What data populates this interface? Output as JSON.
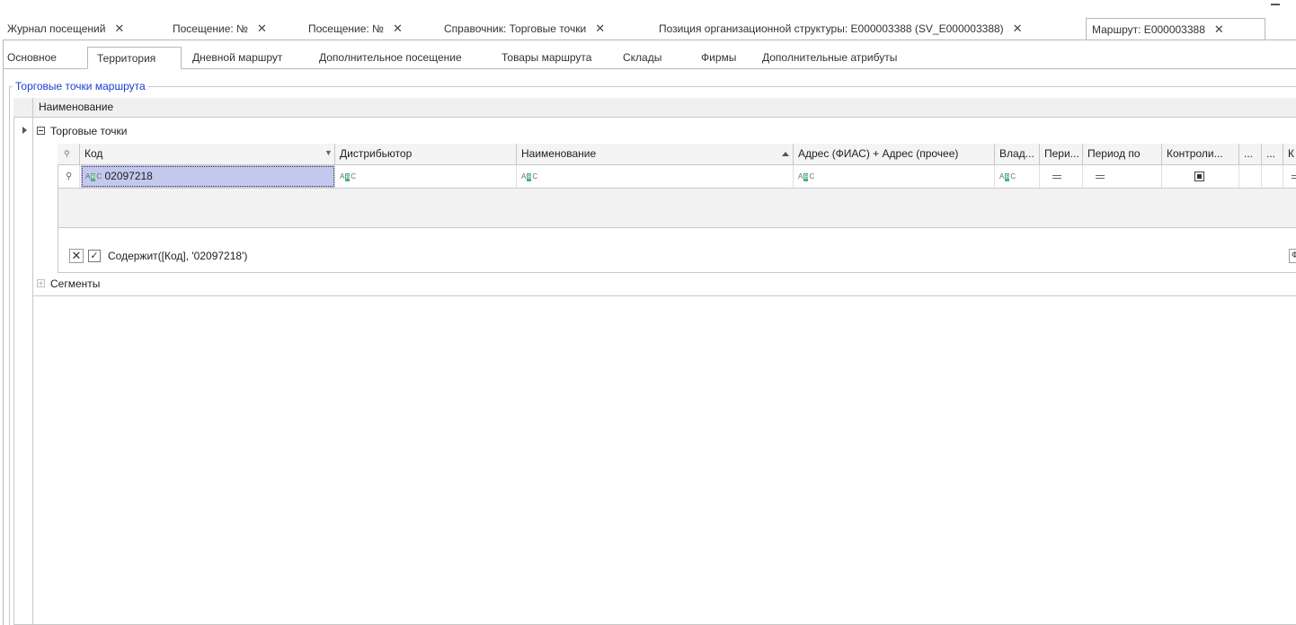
{
  "doc_tabs": [
    {
      "label": "Журнал посещений",
      "active": false
    },
    {
      "label": "Посещение: №",
      "active": false
    },
    {
      "label": "Посещение: №",
      "active": false
    },
    {
      "label": "Справочник: Торговые точки",
      "active": false
    },
    {
      "label": "Позиция организационной структуры: E000003388 (SV_E000003388)",
      "active": false
    },
    {
      "label": "Маршрут: E000003388",
      "active": true
    }
  ],
  "close_glyph": "✕",
  "form_tabs": [
    {
      "label": "Основное",
      "active": false
    },
    {
      "label": "Территория",
      "active": true
    },
    {
      "label": "Дневной маршрут",
      "active": false
    },
    {
      "label": "Дополнительное посещение",
      "active": false
    },
    {
      "label": "Товары маршрута",
      "active": false
    },
    {
      "label": "Склады",
      "active": false
    },
    {
      "label": "Фирмы",
      "active": false
    },
    {
      "label": "Дополнительные атрибуты",
      "active": false
    }
  ],
  "group": {
    "title": "Торговые точки маршрута"
  },
  "outer_grid": {
    "header": "Наименование",
    "rows": [
      {
        "label": "Торговые точки",
        "expanded": true
      },
      {
        "label": "Сегменты",
        "expanded": false
      }
    ]
  },
  "nested_grid": {
    "columns": [
      "Код",
      "Дистрибьютор",
      "Наименование",
      "Адрес (ФИАС) + Адрес (прочее)",
      "Влад...",
      "Пери...",
      "Период по",
      "Контроли...",
      "...",
      "...",
      "К"
    ],
    "filter_row": {
      "code": "02097218"
    },
    "abc_glyph": "A B C",
    "filter": {
      "expression": "Содержит([Код], '02097218')",
      "edit_label": "Ф"
    }
  },
  "colors": {
    "group_title": "#1a3dd0",
    "edit_cell": "#c5c8ee",
    "abc_badge": "#4caf78"
  }
}
